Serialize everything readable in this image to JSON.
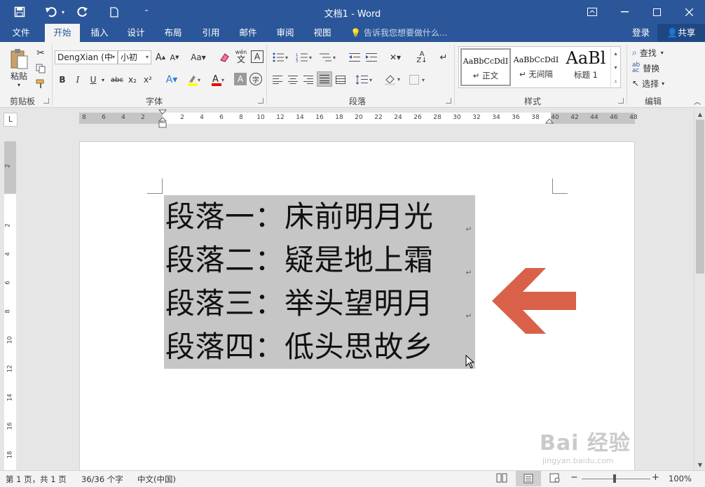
{
  "window": {
    "title": "文档1 - Word",
    "qat": {
      "save_icon": "save-icon",
      "undo_icon": "undo-icon",
      "redo_icon": "redo-icon",
      "new_icon": "new-document-icon",
      "customize_icon": "customize-qat-icon"
    },
    "controls": {
      "ribbon_display": "ribbon-display-icon",
      "minimize": "minimize-icon",
      "maximize": "maximize-icon",
      "close": "close-icon"
    }
  },
  "tabs": [
    "文件",
    "开始",
    "插入",
    "设计",
    "布局",
    "引用",
    "邮件",
    "审阅",
    "视图"
  ],
  "active_tab": "开始",
  "tell_me": "告诉我您想要做什么...",
  "sign_in": "登录",
  "share": "共享",
  "ribbon": {
    "clipboard": {
      "label": "剪贴板",
      "paste": "粘贴"
    },
    "font": {
      "label": "字体",
      "font_name": "DengXian (中",
      "font_size": "小初",
      "buttons": [
        "B",
        "I",
        "U",
        "abc",
        "x₂",
        "x²"
      ],
      "phonetic": "wén",
      "phonetic_sub": "文"
    },
    "paragraph": {
      "label": "段落"
    },
    "styles": {
      "label": "样式",
      "items": [
        {
          "sample": "AaBbCcDdI",
          "name": "↵ 正文"
        },
        {
          "sample": "AaBbCcDdI",
          "name": "↵ 无间隔"
        },
        {
          "sample": "AaBl",
          "name": "标题 1"
        }
      ]
    },
    "editing": {
      "label": "编辑",
      "find": "查找",
      "replace": "替换",
      "select": "选择"
    }
  },
  "ruler": {
    "h_left": [
      "8",
      "6",
      "4",
      "2"
    ],
    "h_main": [
      "2",
      "4",
      "6",
      "8",
      "10",
      "12",
      "14",
      "16",
      "18",
      "20",
      "22",
      "24",
      "26",
      "28",
      "30",
      "32",
      "34",
      "36",
      "38"
    ],
    "h_right": [
      "40",
      "42",
      "44",
      "46",
      "48"
    ],
    "v_top": [
      "2"
    ],
    "v_main": [
      "2",
      "4",
      "6",
      "8",
      "10",
      "12",
      "14",
      "16",
      "18"
    ]
  },
  "document": {
    "paragraphs": [
      "段落一：床前明月光",
      "段落二：疑是地上霜",
      "段落三：举头望明月",
      "段落四：低头思故乡"
    ],
    "paragraph_mark": "↵",
    "arrow_color": "#d9614a",
    "selection_color": "#c6c6c6"
  },
  "status": {
    "page": "第 1 页，共 1 页",
    "words": "36/36 个字",
    "language": "中文(中国)",
    "zoom": "100%",
    "zoom_minus": "−",
    "zoom_plus": "+"
  },
  "watermark": {
    "brand": "Bai 经验",
    "url": "jingyan.baidu.com"
  }
}
